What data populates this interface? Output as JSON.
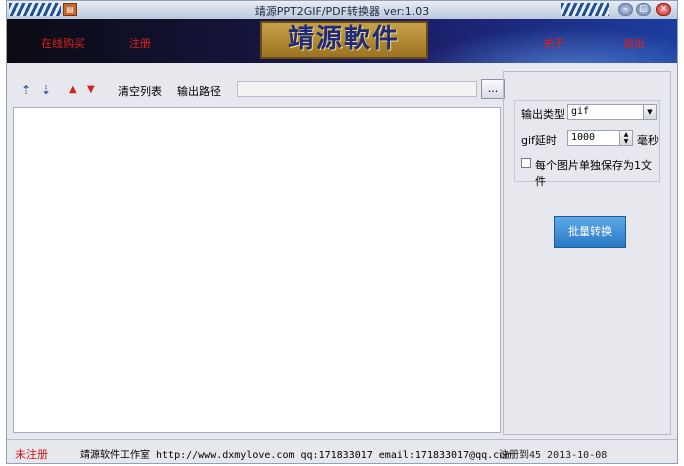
{
  "window": {
    "title": "靖源PPT2GIF/PDF转换器 ver:1.03",
    "app_icon_glyph": "▤"
  },
  "banner": {
    "buy_online": "在线购买",
    "register": "注册",
    "logo_text": "靖源軟件",
    "about": "关于",
    "exit": "退出"
  },
  "toolbar": {
    "icon_move_top": "⇡",
    "icon_move_bottom": "⇣",
    "icon_up": "▲",
    "icon_down": "▼",
    "clear_list": "清空列表",
    "output_path_label": "输出路径",
    "output_path_value": "",
    "browse_label": "..."
  },
  "options": {
    "output_type_label": "输出类型",
    "output_type_value": "gif",
    "delay_label": "gif延时",
    "delay_value": "1000",
    "delay_unit": "毫秒",
    "separate_file_label": "每个图片单独保存为1文件",
    "separate_file_checked": false
  },
  "actions": {
    "batch_convert": "批量转换"
  },
  "status": {
    "unregistered": "未注册",
    "info": "靖源软件工作室 http://www.dxmylove.com qq:171833017 email:171833017@qq.com",
    "reg_info": "注册到45  2013-10-08"
  },
  "colors": {
    "banner_link": "#e0201a",
    "convert_button": "#3d8fd8",
    "unregistered": "#d01010"
  }
}
